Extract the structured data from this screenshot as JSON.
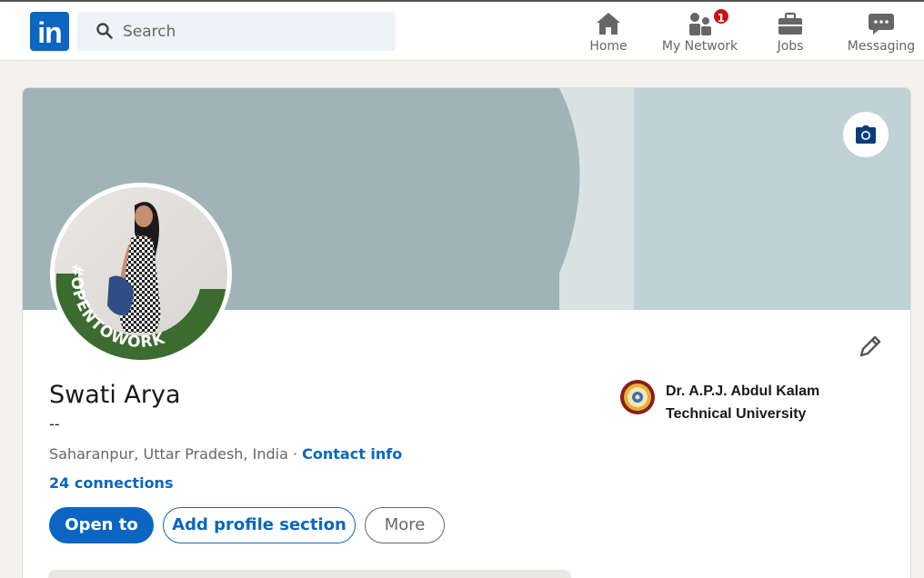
{
  "brand": {
    "logo_text": "in",
    "color": "#0a66c2"
  },
  "search": {
    "placeholder": "Search"
  },
  "nav": [
    {
      "label": "Home",
      "icon": "home-icon"
    },
    {
      "label": "My Network",
      "icon": "my-network-icon",
      "badge": "1"
    },
    {
      "label": "Jobs",
      "icon": "briefcase-icon"
    },
    {
      "label": "Messaging",
      "icon": "chat-icon"
    }
  ],
  "profile": {
    "name": "Swati Arya",
    "headline": "--",
    "location": "Saharanpur, Uttar Pradesh, India",
    "separator": " · ",
    "contact_label": "Contact info",
    "connections": "24 connections",
    "frame_text": "#OPENTOWORK"
  },
  "actions": {
    "open_to": "Open to",
    "add_section": "Add profile section",
    "more": "More"
  },
  "education": {
    "name_line1": "Dr. A.P.J. Abdul Kalam",
    "name_line2": "Technical University"
  },
  "colors": {
    "accent": "#0a66c2",
    "badge": "#cc1016",
    "open_to_work_ring": "#3b6b2f",
    "cover_dark": "#a0b4b7",
    "cover_light": "#d8e2e3",
    "cover_right": "#bfd2d5"
  }
}
